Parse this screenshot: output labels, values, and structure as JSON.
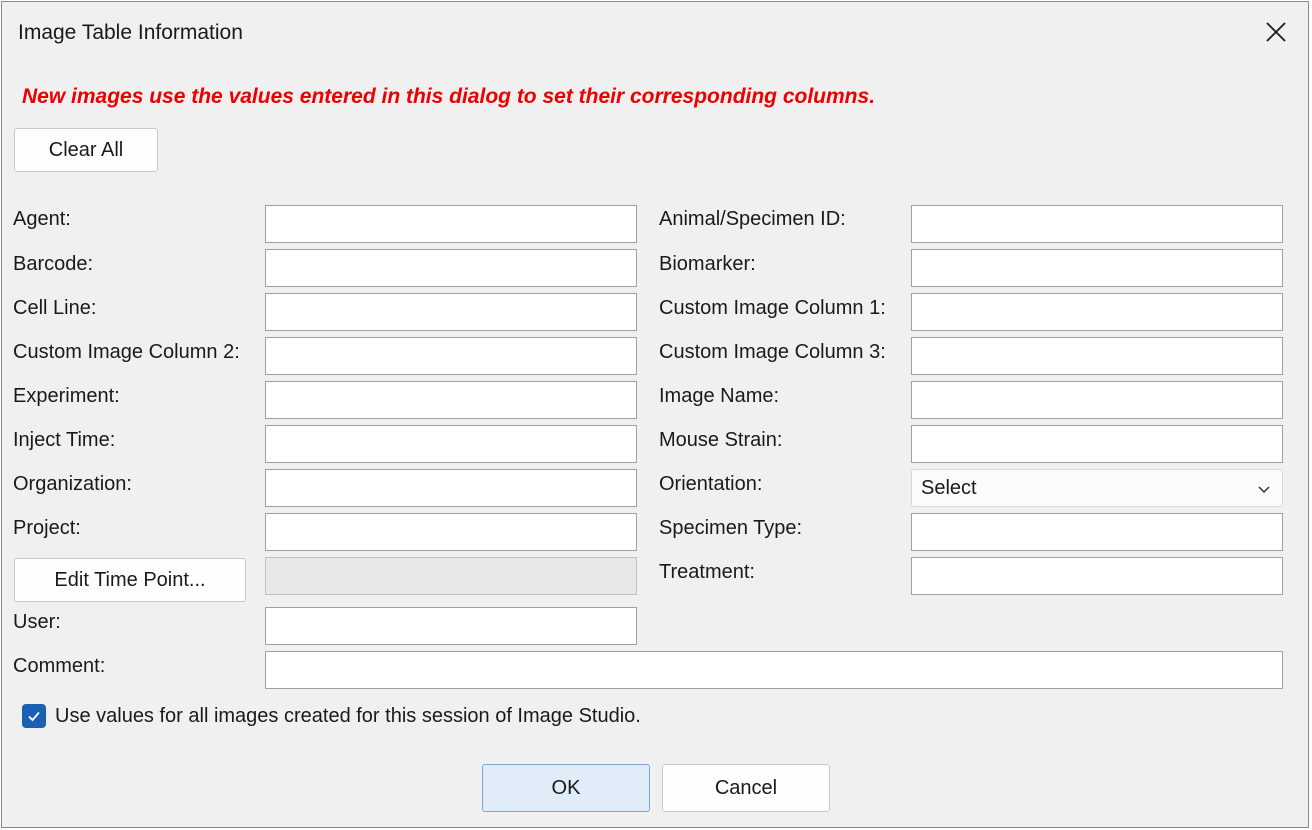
{
  "dialog": {
    "title": "Image Table Information",
    "notice": "New images use the values entered in this dialog to set their corresponding columns.",
    "clear_all_label": "Clear All",
    "edit_time_point_label": "Edit Time Point...",
    "ok_label": "OK",
    "cancel_label": "Cancel",
    "checkbox_label": "Use values for all images created for this session of Image Studio.",
    "checkbox_checked": true,
    "accent_color": "#1a5fb4",
    "notice_color": "#ee0000"
  },
  "left_fields": [
    {
      "label": "Agent:",
      "value": ""
    },
    {
      "label": "Barcode:",
      "value": ""
    },
    {
      "label": "Cell Line:",
      "value": ""
    },
    {
      "label": "Custom Image Column 2:",
      "value": ""
    },
    {
      "label": "Experiment:",
      "value": ""
    },
    {
      "label": "Inject Time:",
      "value": ""
    },
    {
      "label": "Organization:",
      "value": ""
    },
    {
      "label": "Project:",
      "value": ""
    }
  ],
  "time_point": {
    "value": ""
  },
  "user": {
    "label": "User:",
    "value": ""
  },
  "comment": {
    "label": "Comment:",
    "value": ""
  },
  "right_fields": [
    {
      "label": "Animal/Specimen ID:",
      "value": ""
    },
    {
      "label": "Biomarker:",
      "value": ""
    },
    {
      "label": "Custom Image Column 1:",
      "value": ""
    },
    {
      "label": "Custom Image Column 3:",
      "value": ""
    },
    {
      "label": "Image Name:",
      "value": ""
    },
    {
      "label": "Mouse Strain:",
      "value": ""
    }
  ],
  "orientation": {
    "label": "Orientation:",
    "selected": "Select"
  },
  "right_fields_after": [
    {
      "label": "Specimen Type:",
      "value": ""
    },
    {
      "label": "Treatment:",
      "value": ""
    }
  ]
}
